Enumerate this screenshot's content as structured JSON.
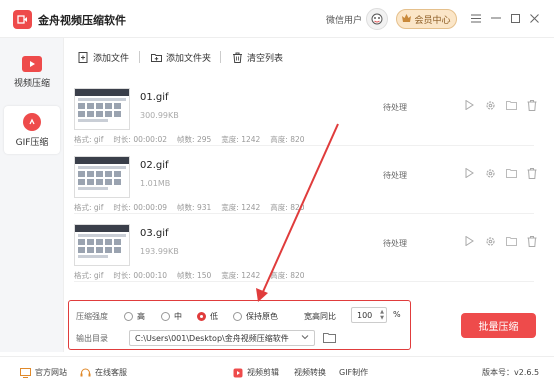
{
  "app": {
    "title": "金舟视频压缩软件"
  },
  "header": {
    "user_name": "微信用户",
    "vip_label": "会员中心"
  },
  "sidebar": {
    "items": [
      {
        "label": "视频压缩"
      },
      {
        "label": "GIF压缩"
      }
    ]
  },
  "toolbar": {
    "add_file": "添加文件",
    "add_folder": "添加文件夹",
    "clear_list": "清空列表"
  },
  "meta_labels": {
    "format": "格式:",
    "duration": "时长:",
    "frames": "帧数:",
    "width": "宽度:",
    "height": "高度:"
  },
  "files": [
    {
      "name": "01.gif",
      "size": "300.99KB",
      "status": "待处理",
      "format": "gif",
      "duration": "00:00:02",
      "frames": "295",
      "width": "1242",
      "height": "820"
    },
    {
      "name": "02.gif",
      "size": "1.01MB",
      "status": "待处理",
      "format": "gif",
      "duration": "00:00:09",
      "frames": "931",
      "width": "1242",
      "height": "820"
    },
    {
      "name": "03.gif",
      "size": "193.99KB",
      "status": "待处理",
      "format": "gif",
      "duration": "00:00:10",
      "frames": "150",
      "width": "1242",
      "height": "820"
    }
  ],
  "settings": {
    "strength_label": "压缩强度",
    "options": [
      "高",
      "中",
      "低",
      "保持原色"
    ],
    "selected_option": "低",
    "ratio_label": "宽高同比",
    "ratio_value": "100",
    "ratio_unit": "%",
    "output_label": "输出目录",
    "output_path": "C:\\Users\\001\\Desktop\\金舟视频压缩软件"
  },
  "batch_button": "批量压缩",
  "footer": {
    "website": "官方网站",
    "support": "在线客服",
    "video_edit": "视频剪辑",
    "video_convert": "视频转换",
    "gif_make": "GIF制作",
    "version": "版本号：v2.6.5"
  },
  "colors": {
    "accent": "#ee4b4b",
    "annotation": "#e03c3c"
  }
}
